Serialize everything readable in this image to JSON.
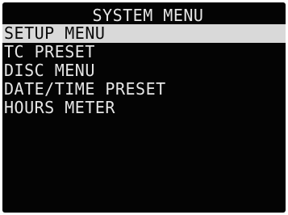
{
  "menu": {
    "title": "SYSTEM MENU",
    "items": [
      {
        "label": "SETUP MENU",
        "selected": true
      },
      {
        "label": "TC PRESET",
        "selected": false
      },
      {
        "label": "DISC MENU",
        "selected": false
      },
      {
        "label": "DATE/TIME PRESET",
        "selected": false
      },
      {
        "label": "HOURS METER",
        "selected": false
      }
    ]
  },
  "colors": {
    "background": "#040404",
    "text": "#e6e6e6",
    "highlight": "#d9d9d9",
    "highlight_text": "#0a0a0a"
  }
}
